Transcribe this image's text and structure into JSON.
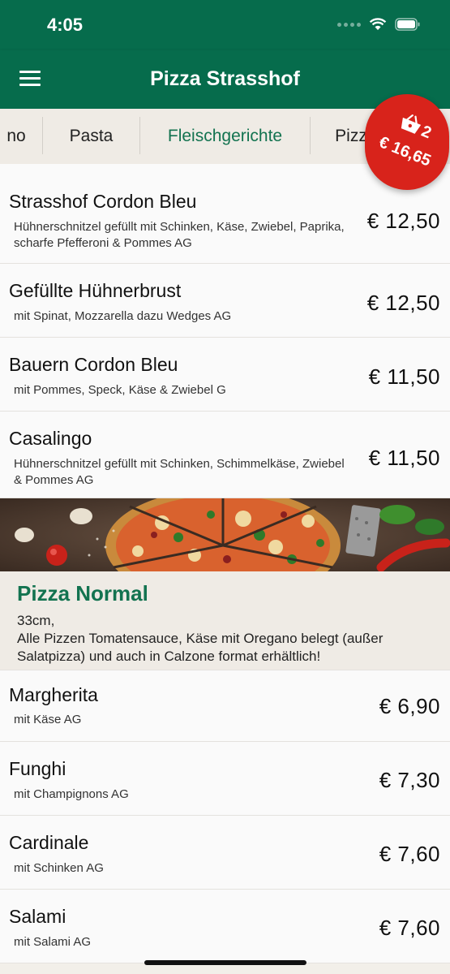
{
  "status": {
    "time": "4:05"
  },
  "app": {
    "title": "Pizza Strasshof"
  },
  "tabs": [
    {
      "label": "no"
    },
    {
      "label": "Pasta"
    },
    {
      "label": "Fleischgerichte"
    },
    {
      "label": "Pizz"
    }
  ],
  "cart": {
    "count": "2",
    "total": "€ 16,65"
  },
  "meat_items": [
    {
      "name": "Strasshof Cordon Bleu",
      "desc": "Hühnerschnitzel gefüllt mit Schinken, Käse, Zwiebel, Paprika, scharfe Pfefferoni & Pommes AG",
      "price": "€ 12,50"
    },
    {
      "name": "Gefüllte Hühnerbrust",
      "desc": "mit Spinat, Mozzarella dazu Wedges AG",
      "price": "€ 12,50"
    },
    {
      "name": "Bauern Cordon Bleu",
      "desc": "mit Pommes, Speck, Käse & Zwiebel G",
      "price": "€ 11,50"
    },
    {
      "name": "Casalingo",
      "desc": "Hühnerschnitzel gefüllt mit Schinken, Schimmelkäse, Zwiebel & Pommes AG",
      "price": "€ 11,50"
    }
  ],
  "pizza_section": {
    "title": "Pizza Normal",
    "desc_line1": "33cm,",
    "desc_line2": "Alle Pizzen Tomatensauce, Käse mit Oregano belegt (außer Salatpizza) und auch in Calzone format erhältlich!"
  },
  "pizza_items": [
    {
      "name": "Margherita",
      "desc": "mit Käse AG",
      "price": "€ 6,90"
    },
    {
      "name": "Funghi",
      "desc": "mit Champignons AG",
      "price": "€ 7,30"
    },
    {
      "name": "Cardinale",
      "desc": "mit Schinken AG",
      "price": "€ 7,60"
    },
    {
      "name": "Salami",
      "desc": "mit Salami AG",
      "price": "€ 7,60"
    }
  ],
  "colors": {
    "primary": "#066c4c",
    "accent_text": "#137350",
    "cart": "#d8231b",
    "tab_bg": "#efebe5"
  },
  "icons": [
    "menu-icon",
    "wifi-icon",
    "battery-icon",
    "basket-icon"
  ]
}
